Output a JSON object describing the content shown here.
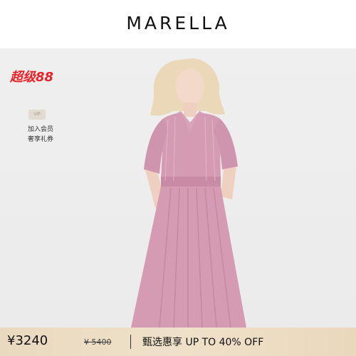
{
  "header": {
    "brand": "MARELLA"
  },
  "promo": {
    "label": "超级88"
  },
  "vip": {
    "badge": "VIP",
    "line1": "加入会员",
    "line2": "奢享礼券"
  },
  "footer": {
    "price": "¥3240",
    "original_price": "¥ 5400",
    "promo_text": "甄选惠享  UP TO 40% OFF"
  },
  "colors": {
    "promo_red": "#e8232a",
    "dress_pink": "#d59bb3",
    "footer_gold": "#ecdcc3"
  }
}
